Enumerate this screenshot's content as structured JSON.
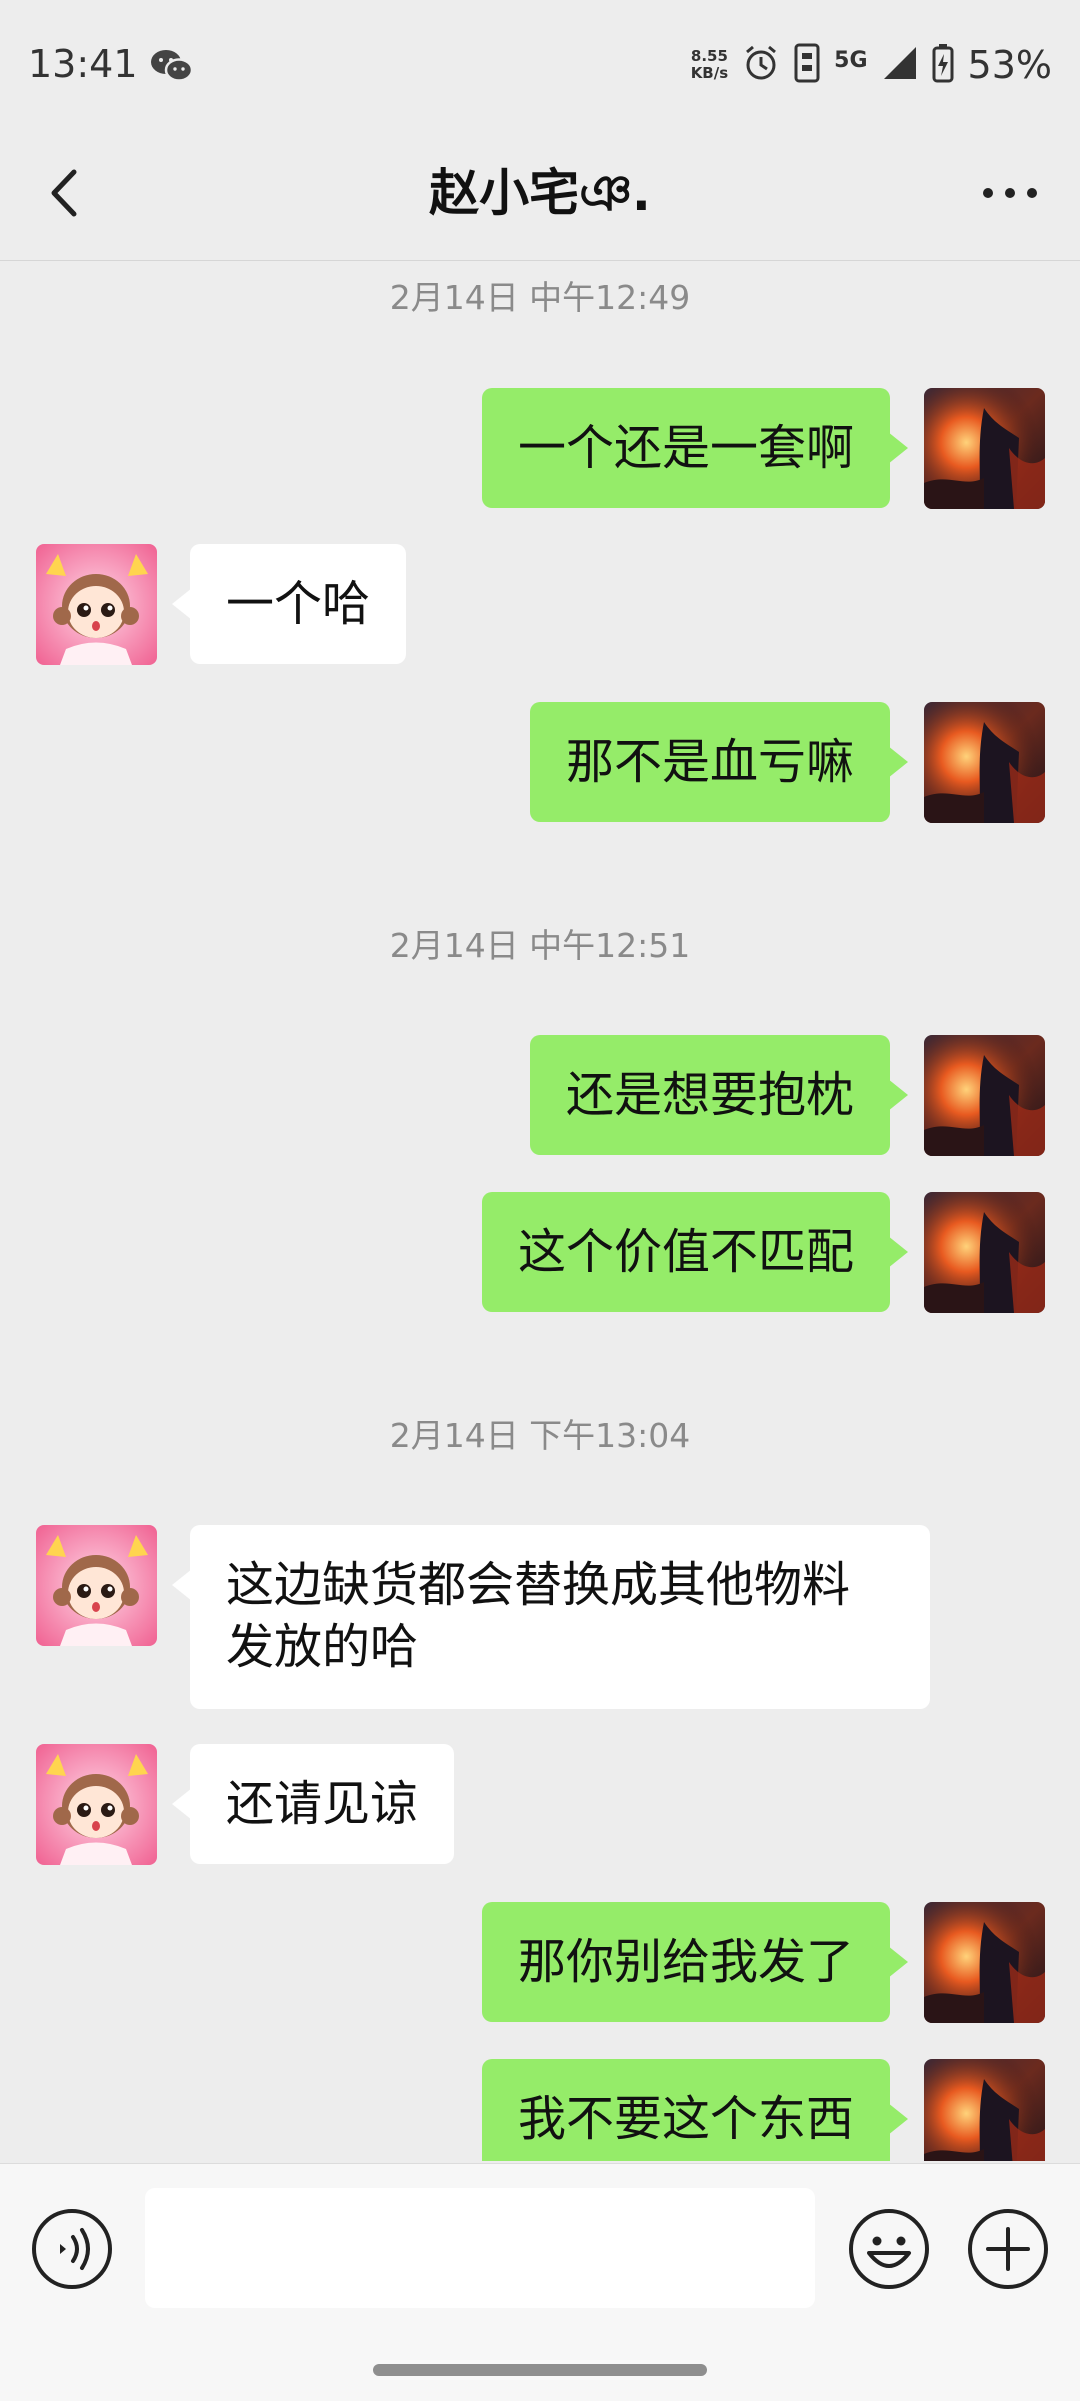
{
  "status_bar": {
    "time": "13:41",
    "net_speed_value": "8.55",
    "net_speed_unit": "KB/s",
    "network": "5G",
    "battery": "53%",
    "icons": [
      "wechat-icon",
      "alarm-icon",
      "sim-icon",
      "signal-icon",
      "battery-charging-icon"
    ]
  },
  "header": {
    "title": "赵小宅ঞ.",
    "back_icon": "chevron-left-icon",
    "more_icon": "more-dots-icon"
  },
  "chat": {
    "timestamps": [
      "2月14日 中午12:49",
      "2月14日 中午12:51",
      "2月14日 下午13:04"
    ],
    "messages": [
      {
        "from": "me",
        "text": "一个还是一套啊"
      },
      {
        "from": "them",
        "text": "一个哈"
      },
      {
        "from": "me",
        "text": "那不是血亏嘛"
      },
      {
        "from": "me",
        "text": "还是想要抱枕"
      },
      {
        "from": "me",
        "text": "这个价值不匹配"
      },
      {
        "from": "them",
        "text": "这边缺货都会替换成其他物料发放的哈"
      },
      {
        "from": "them",
        "text": "还请见谅"
      },
      {
        "from": "me",
        "text": "那你别给我发了"
      },
      {
        "from": "me",
        "text": "我不要这个东西"
      }
    ]
  },
  "input_bar": {
    "placeholder": "",
    "icons": [
      "voice-icon",
      "emoji-icon",
      "plus-icon"
    ]
  },
  "colors": {
    "my_bubble": "#95ec69",
    "their_bubble": "#ffffff",
    "background": "#ededed"
  }
}
